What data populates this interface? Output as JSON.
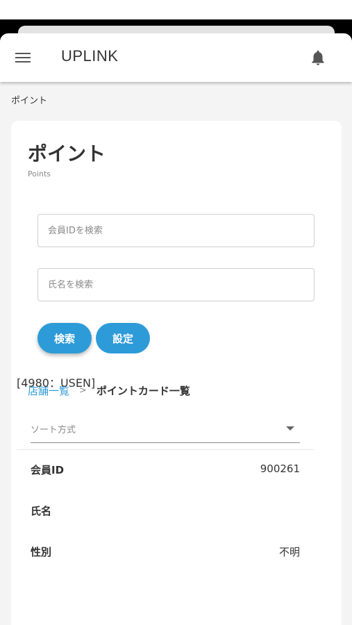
{
  "app": {
    "title": "UPLINK"
  },
  "icons": {
    "menu": "menu-icon",
    "notifications": "bell-icon"
  },
  "colors": {
    "accent": "#2d9bd8",
    "background": "#f4f4f4",
    "text": "#333333"
  },
  "breadcrumb_top": "ポイント",
  "page": {
    "title": "ポイント",
    "subtitle": "Points"
  },
  "search": {
    "member_id_placeholder": "会員IDを検索",
    "name_placeholder": "氏名を検索",
    "search_button": "検索",
    "settings_button": "設定"
  },
  "breadcrumb": {
    "parent": "店舗一覧",
    "separator": ">",
    "current": "ポイントカード一覧"
  },
  "store": "[4980：USEN]",
  "sort": {
    "label": "ソート方式"
  },
  "details": [
    {
      "label": "会員ID",
      "value": "900261"
    },
    {
      "label": "氏名",
      "value": ""
    },
    {
      "label": "性別",
      "value": "不明"
    }
  ]
}
